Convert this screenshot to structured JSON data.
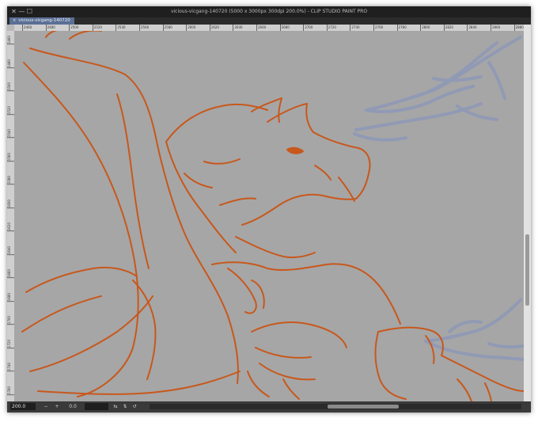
{
  "window": {
    "title": "vicious-vicgang-140720 (5000 x 3000px 300dpi 200.0%)  - CLIP STUDIO PAINT PRO",
    "close_glyph": "✕",
    "minimize_glyph": "—",
    "maximize_glyph": "☐"
  },
  "tabs": [
    {
      "label": "vicious-vicgang-140720",
      "close_glyph": "×"
    }
  ],
  "rulers": {
    "horizontal": [
      "2460",
      "2480",
      "2500",
      "2520",
      "2540",
      "2560",
      "2580",
      "2600",
      "2620",
      "2640",
      "2660",
      "2680",
      "2700",
      "2720",
      "2740",
      "2760",
      "2780",
      "2800",
      "2820",
      "2840",
      "2860",
      "2880"
    ],
    "vertical": [
      "1460",
      "1480",
      "1500",
      "1520",
      "1540",
      "1560",
      "1580",
      "1600",
      "1620",
      "1640",
      "1660",
      "1680",
      "1700",
      "1720",
      "1740",
      "1760"
    ]
  },
  "canvas": {
    "background_color": "#a6a6a6",
    "lineart_color": "#c8581c",
    "sketch_color": "#8e98b8"
  },
  "status": {
    "zoom": "200.0",
    "zoom_out_glyph": "−",
    "zoom_in_glyph": "+",
    "rotation": "0.0",
    "flip_h_glyph": "⇆",
    "flip_v_glyph": "⇅",
    "reset_glyph": "↺"
  }
}
